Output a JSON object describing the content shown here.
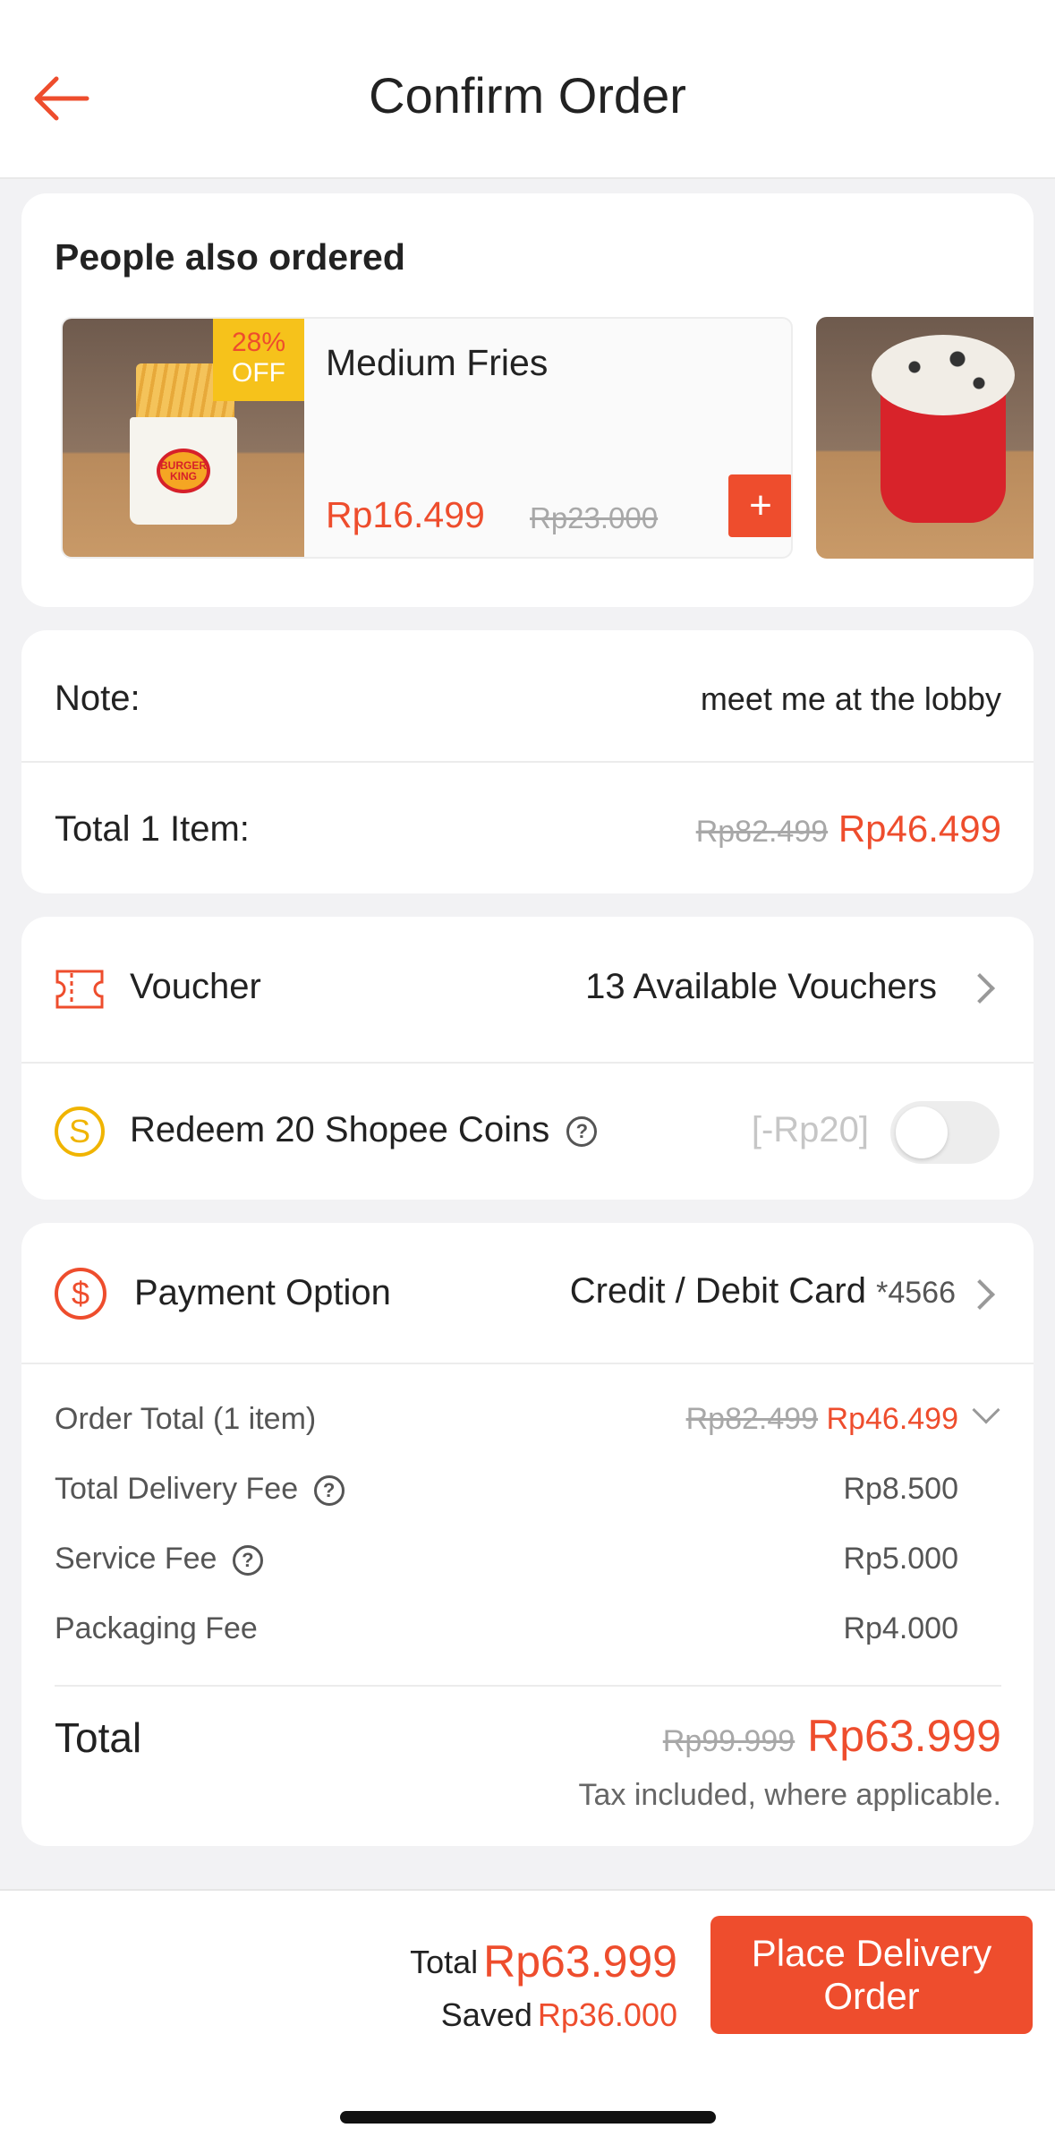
{
  "header": {
    "title": "Confirm Order"
  },
  "people_also_ordered": {
    "title": "People also ordered",
    "products": [
      {
        "name": "Medium Fries",
        "discount_pct": "28%",
        "discount_off": "OFF",
        "price": "Rp16.499",
        "old_price": "Rp23.000",
        "add_label": "+"
      }
    ]
  },
  "order": {
    "note_label": "Note:",
    "note_value": "meet me at the lobby",
    "total_items_label": "Total 1 Item:",
    "total_items_old": "Rp82.499",
    "total_items_new": "Rp46.499"
  },
  "voucher": {
    "label": "Voucher",
    "value": "13 Available Vouchers"
  },
  "coins": {
    "icon_letter": "S",
    "label": "Redeem 20 Shopee Coins",
    "help": "?",
    "value": "[-Rp20]",
    "toggle_on": false
  },
  "payment": {
    "icon_symbol": "$",
    "label": "Payment Option",
    "method": "Credit / Debit Card",
    "card_suffix": "*4566"
  },
  "fees": {
    "order_total_label": "Order Total (1 item)",
    "order_total_old": "Rp82.499",
    "order_total_new": "Rp46.499",
    "delivery_label": "Total Delivery Fee",
    "delivery_value": "Rp8.500",
    "service_label": "Service Fee",
    "service_value": "Rp5.000",
    "packaging_label": "Packaging Fee",
    "packaging_value": "Rp4.000",
    "help": "?"
  },
  "total": {
    "label": "Total",
    "old": "Rp99.999",
    "new": "Rp63.999",
    "note": "Tax included, where applicable."
  },
  "bottom_bar": {
    "total_label": "Total",
    "total_value": "Rp63.999",
    "saved_label": "Saved",
    "saved_value": "Rp36.000",
    "place_order": "Place Delivery Order"
  },
  "colors": {
    "accent": "#ee4d2d",
    "coin": "#f0b400"
  }
}
